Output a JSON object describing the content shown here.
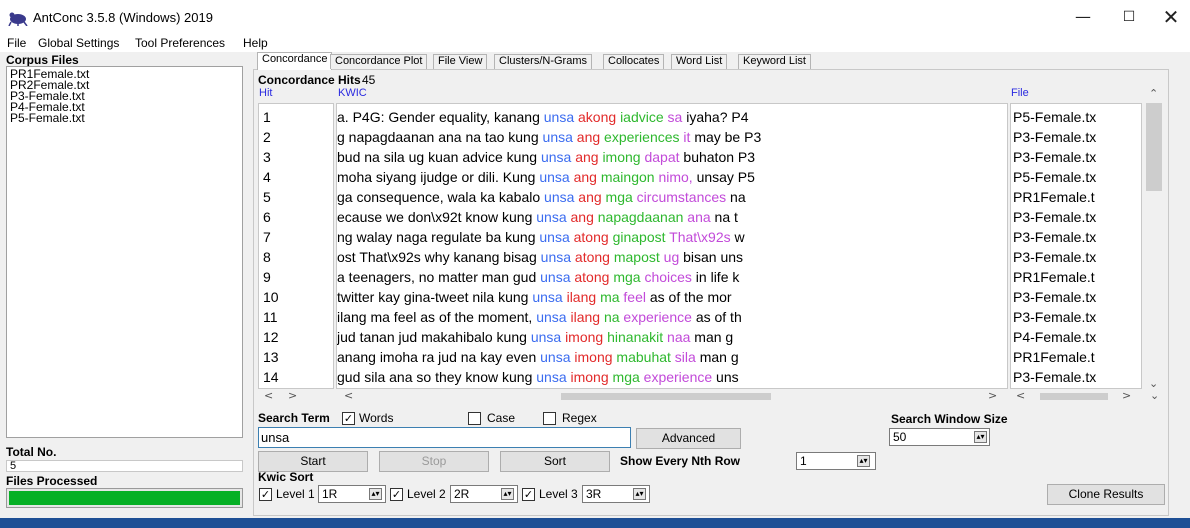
{
  "window": {
    "title": "AntConc 3.5.8 (Windows) 2019",
    "minimize": "—",
    "maximize": "☐",
    "close": "✕"
  },
  "menu": [
    "File",
    "Global Settings",
    "Tool Preferences",
    "Help"
  ],
  "corpus": {
    "header": "Corpus Files",
    "files": [
      "PR1Female.txt",
      "PR2Female.txt",
      "P3-Female.txt",
      "P4-Female.txt",
      "P5-Female.txt"
    ],
    "total_label": "Total No.",
    "total_value": "5",
    "processed_label": "Files Processed",
    "progress": 1.0
  },
  "tabs": [
    "Concordance",
    "Concordance Plot",
    "File View",
    "Clusters/N-Grams",
    "Collocates",
    "Word List",
    "Keyword List"
  ],
  "concordance": {
    "hits_label": "Concordance Hits",
    "hits_count": "45",
    "col_hit": "Hit",
    "col_kwic": "KWIC",
    "col_file": "File",
    "rows": [
      {
        "hit": "1",
        "left": "a. P4G: Gender equality, kanang ",
        "kw": "unsa",
        "r1": "akong",
        "r2": "iadvice",
        "r3": "sa",
        "right": "iyaha?  P4",
        "file": "P5-Female.tx"
      },
      {
        "hit": "2",
        "left": "g napagdaanan ana na tao kung ",
        "kw": "unsa",
        "r1": "ang",
        "r2": "experiences",
        "r3": "it",
        "right": "may be  P3",
        "file": "P3-Female.tx"
      },
      {
        "hit": "3",
        "left": "bud na sila ug kuan advice kung ",
        "kw": "unsa",
        "r1": "ang",
        "r2": "imong",
        "r3": "dapat",
        "right": "buhaton  P3",
        "file": "P3-Female.tx"
      },
      {
        "hit": "4",
        "left": "moha siyang ijudge or dili. Kung ",
        "kw": "unsa",
        "r1": "ang",
        "r2": "maingon",
        "r3": "nimo,",
        "right": "unsay  P5",
        "file": "P5-Female.tx"
      },
      {
        "hit": "5",
        "left": "ga consequence, wala ka kabalo ",
        "kw": "unsa",
        "r1": "ang",
        "r2": "mga",
        "r3": "circumstances",
        "right": "na",
        "file": "PR1Female.t"
      },
      {
        "hit": "6",
        "left": "ecause we don\\x92t know kung ",
        "kw": "unsa",
        "r1": "ang",
        "r2": "napagdaanan",
        "r3": "ana",
        "right": "na t",
        "file": "P3-Female.tx"
      },
      {
        "hit": "7",
        "left": "ng walay naga regulate ba kung ",
        "kw": "unsa",
        "r1": "atong",
        "r2": "ginapost",
        "r3": "That\\x92s",
        "right": "w",
        "file": "P3-Female.tx"
      },
      {
        "hit": "8",
        "left": "ost That\\x92s why kanang bisag ",
        "kw": "unsa",
        "r1": "atong",
        "r2": "mapost",
        "r3": "ug",
        "right": "bisan uns",
        "file": "P3-Female.tx"
      },
      {
        "hit": "9",
        "left": "a teenagers, no matter man gud ",
        "kw": "unsa",
        "r1": "atong",
        "r2": "mga",
        "r3": "choices",
        "right": "in life k",
        "file": "PR1Female.t"
      },
      {
        "hit": "10",
        "left": "twitter kay gina-tweet nila kung ",
        "kw": "unsa",
        "r1": "ilang",
        "r2": "ma",
        "r3": "feel",
        "right": "as of the mor",
        "file": "P3-Female.tx"
      },
      {
        "hit": "11",
        "left": "ilang ma feel as of the moment, ",
        "kw": "unsa",
        "r1": "ilang",
        "r2": "na",
        "r3": "experience",
        "right": "as of th",
        "file": "P3-Female.tx"
      },
      {
        "hit": "12",
        "left": "jud tanan jud makahibalo kung ",
        "kw": "unsa",
        "r1": "imong",
        "r2": "hinanakit",
        "r3": "naa",
        "right": "man g",
        "file": "P4-Female.tx"
      },
      {
        "hit": "13",
        "left": "anang imoha ra jud na kay even ",
        "kw": "unsa",
        "r1": "imong",
        "r2": "mabuhat",
        "r3": "sila",
        "right": "man g",
        "file": "PR1Female.t"
      },
      {
        "hit": "14",
        "left": "gud sila ana so they know kung ",
        "kw": "unsa",
        "r1": "imong",
        "r2": "mga",
        "r3": "experience",
        "right": "uns",
        "file": "P3-Female.tx"
      }
    ]
  },
  "search": {
    "term_label": "Search Term",
    "words_label": "Words",
    "words_checked": true,
    "case_label": "Case",
    "case_checked": false,
    "regex_label": "Regex",
    "regex_checked": false,
    "value": "unsa",
    "advanced": "Advanced",
    "window_label": "Search Window Size",
    "window_value": "50"
  },
  "buttons": {
    "start": "Start",
    "stop": "Stop",
    "sort": "Sort",
    "clone": "Clone Results"
  },
  "nth": {
    "label": "Show Every Nth Row",
    "value": "1"
  },
  "kwic_sort": {
    "label": "Kwic Sort",
    "levels": [
      {
        "label": "Level 1",
        "value": "1R",
        "checked": true
      },
      {
        "label": "Level 2",
        "value": "2R",
        "checked": true
      },
      {
        "label": "Level 3",
        "value": "3R",
        "checked": true
      }
    ]
  },
  "colors": {
    "keyword": "#3b6cf0",
    "level1": "#e22a2a",
    "level2": "#2eb82e",
    "level3": "#c24ad9",
    "header_blue": "#2b2be0",
    "progress": "#06b025"
  }
}
